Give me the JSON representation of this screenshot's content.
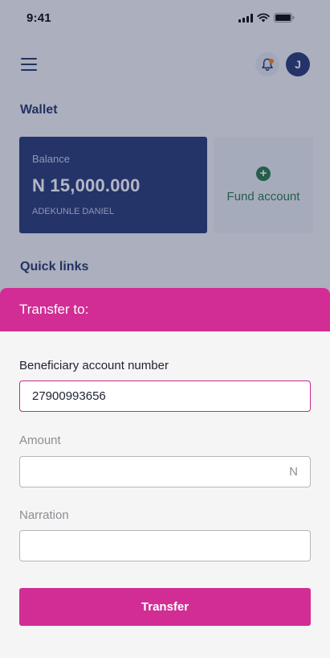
{
  "status_bar": {
    "time": "9:41"
  },
  "header": {
    "menu_icon": "hamburger-menu-icon",
    "bell_icon": "bell-icon",
    "avatar_initial": "J"
  },
  "wallet": {
    "title": "Wallet",
    "balance_label": "Balance",
    "balance_amount": "N 15,000.000",
    "account_name": "ADEKUNLE DANIEL",
    "fund_label": "Fund account",
    "fund_icon": "plus-circle-icon"
  },
  "quick_links": {
    "title": "Quick links"
  },
  "transfer_sheet": {
    "title": "Transfer to:",
    "beneficiary_label": "Beneficiary account number",
    "beneficiary_value": "27900993656",
    "amount_label": "Amount",
    "amount_value": "",
    "amount_suffix": "N",
    "narration_label": "Narration",
    "narration_value": "",
    "submit_label": "Transfer"
  },
  "colors": {
    "brand_pink": "#d12d94",
    "navy": "#2d3e7a",
    "green": "#2e7d4f",
    "bell_dot": "#f08a24"
  }
}
